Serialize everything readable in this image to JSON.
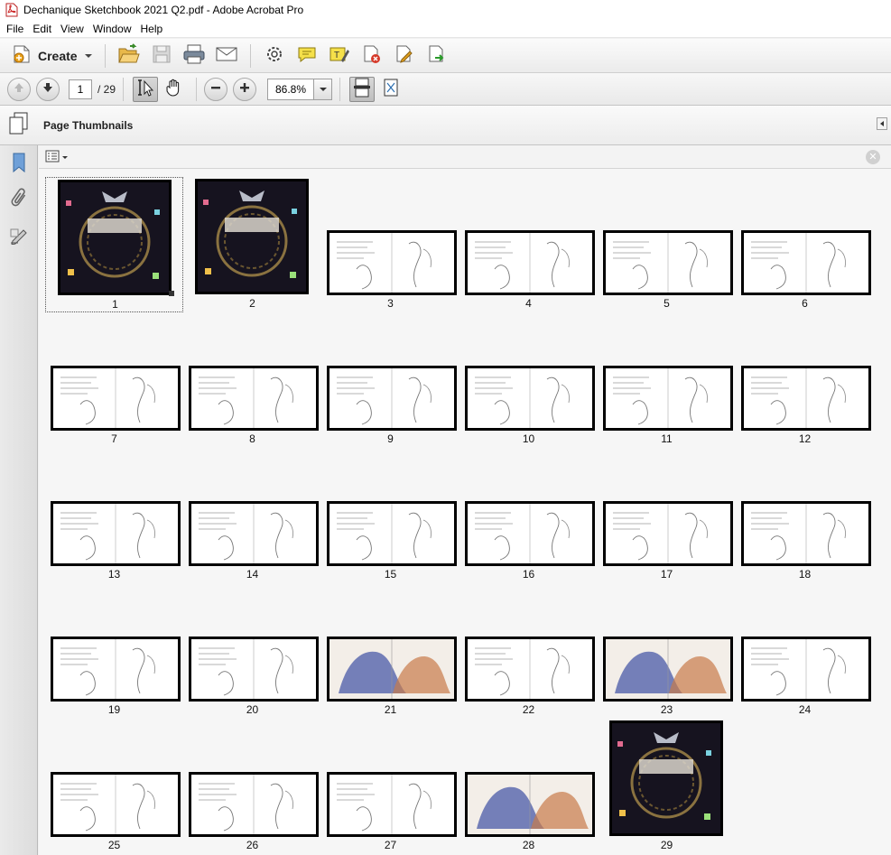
{
  "window": {
    "title": "Dechanique Sketchbook 2021 Q2.pdf - Adobe Acrobat Pro"
  },
  "menu": [
    "File",
    "Edit",
    "View",
    "Window",
    "Help"
  ],
  "toolbar": {
    "create_label": "Create",
    "icons": [
      "open-folder-icon",
      "save-icon",
      "print-icon",
      "email-icon",
      "settings-gear-icon",
      "comment-bubble-icon",
      "highlight-text-icon",
      "delete-page-icon",
      "edit-page-icon",
      "export-icon"
    ]
  },
  "nav": {
    "current_page": "1",
    "total_pages": "/ 29",
    "zoom": "86.8%"
  },
  "panel": {
    "title": "Page Thumbnails"
  },
  "thumbnails": [
    {
      "label": "1",
      "kind": "cover"
    },
    {
      "label": "2",
      "kind": "cover"
    },
    {
      "label": "3",
      "kind": "sketch"
    },
    {
      "label": "4",
      "kind": "sketch"
    },
    {
      "label": "5",
      "kind": "sketch"
    },
    {
      "label": "6",
      "kind": "sketch"
    },
    {
      "label": "7",
      "kind": "sketch"
    },
    {
      "label": "8",
      "kind": "sketch"
    },
    {
      "label": "9",
      "kind": "sketch"
    },
    {
      "label": "10",
      "kind": "sketch"
    },
    {
      "label": "11",
      "kind": "sketch"
    },
    {
      "label": "12",
      "kind": "sketch"
    },
    {
      "label": "13",
      "kind": "sketch"
    },
    {
      "label": "14",
      "kind": "sketch"
    },
    {
      "label": "15",
      "kind": "sketch"
    },
    {
      "label": "16",
      "kind": "sketch"
    },
    {
      "label": "17",
      "kind": "sketch"
    },
    {
      "label": "18",
      "kind": "sketch"
    },
    {
      "label": "19",
      "kind": "sketch"
    },
    {
      "label": "20",
      "kind": "sketch"
    },
    {
      "label": "21",
      "kind": "color"
    },
    {
      "label": "22",
      "kind": "sketch"
    },
    {
      "label": "23",
      "kind": "color"
    },
    {
      "label": "24",
      "kind": "sketch"
    },
    {
      "label": "25",
      "kind": "sketch"
    },
    {
      "label": "26",
      "kind": "sketch"
    },
    {
      "label": "27",
      "kind": "sketch"
    },
    {
      "label": "28",
      "kind": "color"
    },
    {
      "label": "29",
      "kind": "cover"
    }
  ],
  "colors": {
    "accent_red": "#c0392b",
    "cover_bg": "#141220",
    "page_border": "#000000"
  }
}
